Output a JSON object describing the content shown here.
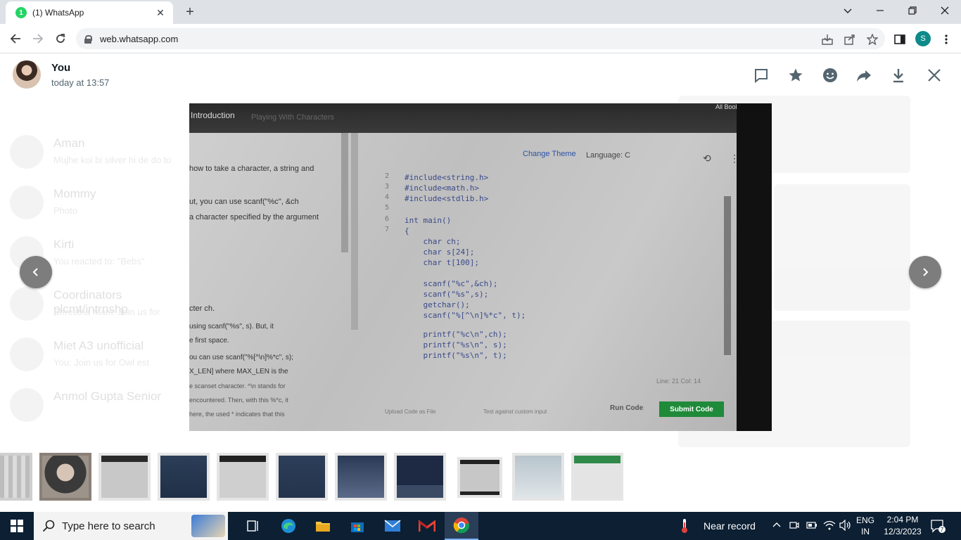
{
  "browser": {
    "tab_badge": "1",
    "tab_title": "(1) WhatsApp",
    "url": "web.whatsapp.com",
    "profile_initial": "S"
  },
  "viewer": {
    "sender": "You",
    "timestamp": "today at 13:57"
  },
  "photo": {
    "tab_intro": "Introduction",
    "tab_other": "Playing With Characters",
    "bookmarks": "All Bookmarks",
    "change_theme": "Change Theme",
    "language": "Language:  C",
    "problem_lines": [
      "how to take a character, a string and",
      "ut, you can use scanf(\"%c\", &ch",
      "a character specified by the argument",
      "cter ch.",
      "using scanf(\"%s\", s). But, it",
      "e first space.",
      "ou can use scanf(\"%[^\\n]%*c\", s);",
      "X_LEN] where MAX_LEN is the",
      "e scanset character. ^\\n stands for",
      "encountered. Then, with this %*c, it",
      "here, the used * indicates that this"
    ],
    "line_numbers": [
      "2",
      "3",
      "4",
      "5",
      "6",
      "7"
    ],
    "code_lines": [
      "#include<string.h>",
      "#include<math.h>",
      "#include<stdlib.h>",
      "",
      "int main()",
      "{",
      "    char ch;",
      "    char s[24];",
      "    char t[100];",
      "",
      "    scanf(\"%c\",&ch);",
      "    scanf(\"%s\",s);",
      "    getchar();",
      "    scanf(\"%[^\\n]%*c\", t);",
      "",
      "    printf(\"%c\\n\",ch);",
      "    printf(\"%s\\n\", s);",
      "    printf(\"%s\\n\", t);"
    ],
    "status": "Line: 21 Col: 14",
    "upload": "Upload Code as File",
    "test_custom": "Test against custom input",
    "run_code": "Run Code",
    "submit_code": "Submit Code"
  },
  "background_chats": [
    {
      "name": "Aman",
      "last": "Mujhe koi bi silver hi de do to"
    },
    {
      "name": "Mommy",
      "last": "Photo"
    },
    {
      "name": "Kirti",
      "last": "You reacted to: \"Bebs\""
    },
    {
      "name": "Coordinators plcmt/intrnshp",
      "last": "Shrestha Mam: Join us for"
    },
    {
      "name": "Miet A3 unofficial",
      "last": "You: Join us for Owl est"
    },
    {
      "name": "Anmol Gupta Senior",
      "last": ""
    }
  ],
  "taskbar": {
    "search_placeholder": "Type here to search",
    "weather": "Near record",
    "lang_top": "ENG",
    "lang_bottom": "IN",
    "time": "2:04 PM",
    "date": "12/3/2023",
    "notification_count": "7"
  },
  "colors": {
    "whatsapp_green": "#25d366",
    "taskbar": "#0c1f33",
    "submit_green": "#1f8a3a"
  }
}
